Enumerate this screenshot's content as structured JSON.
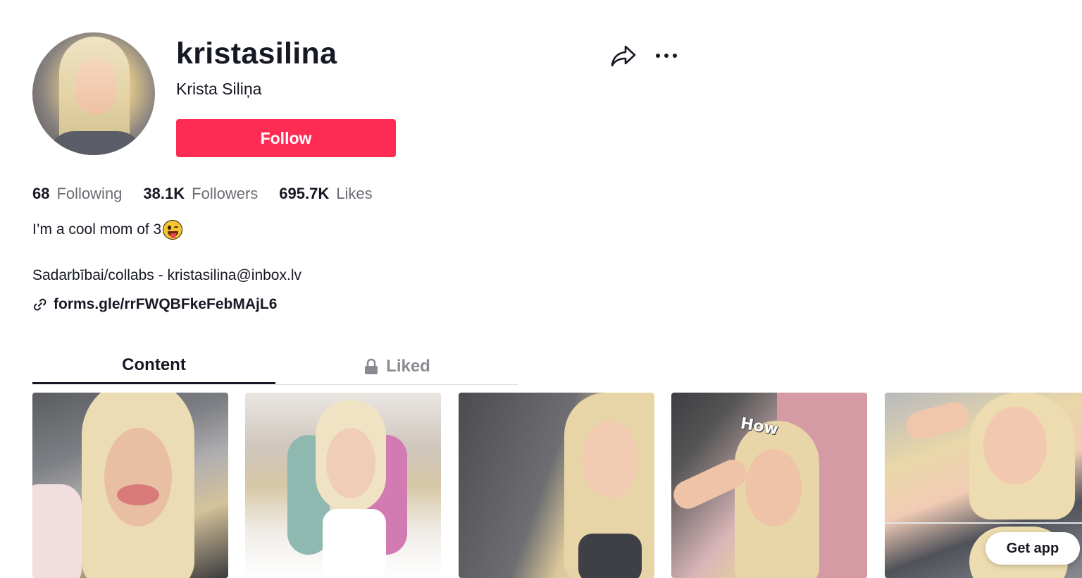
{
  "profile": {
    "username": "kristasilina",
    "display_name": "Krista Siliņa",
    "follow_label": "Follow"
  },
  "stats": {
    "following_count": "68",
    "following_label": "Following",
    "followers_count": "38.1K",
    "followers_label": "Followers",
    "likes_count": "695.7K",
    "likes_label": "Likes"
  },
  "bio": {
    "line1": "I’m a cool mom of 3",
    "line1_emoji": "tongue-out-wink-emoji",
    "collab": "Sadarbībai/collabs - kristasilina@inbox.lv",
    "link": "forms.gle/rrFWQBFkeFebMAjL6"
  },
  "tabs": [
    {
      "label": "Content",
      "active": true
    },
    {
      "label": "Liked",
      "active": false,
      "icon": "lock-icon"
    }
  ],
  "videos": [
    {
      "thumb_overlay": ""
    },
    {
      "thumb_overlay": ""
    },
    {
      "thumb_overlay": ""
    },
    {
      "thumb_overlay": "How"
    },
    {
      "thumb_overlay": ""
    }
  ],
  "get_app_label": "Get app",
  "icons": {
    "share": "share-icon",
    "more": "more-options-icon",
    "link": "link-icon"
  },
  "colors": {
    "accent": "#fe2c55",
    "text_primary": "#161823",
    "text_secondary": "#6b6c73"
  }
}
